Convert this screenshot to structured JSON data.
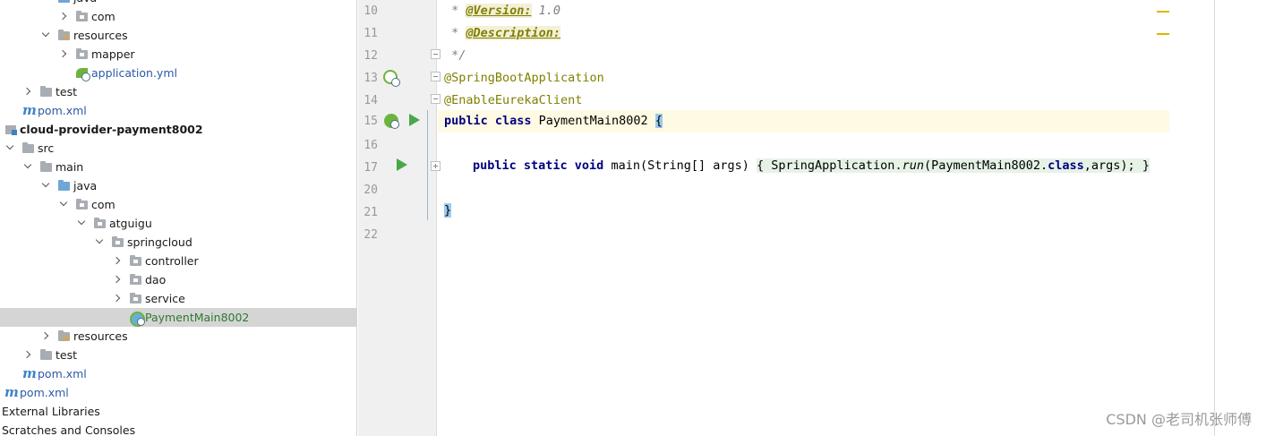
{
  "project_tree": {
    "rows": [
      {
        "label": "java"
      },
      {
        "label": "com"
      },
      {
        "label": "resources"
      },
      {
        "label": "mapper"
      },
      {
        "label": "application.yml"
      },
      {
        "label": "test"
      },
      {
        "label": "pom.xml"
      },
      {
        "label": "cloud-provider-payment8002"
      },
      {
        "label": "src"
      },
      {
        "label": "main"
      },
      {
        "label": "java"
      },
      {
        "label": "com"
      },
      {
        "label": "atguigu"
      },
      {
        "label": "springcloud"
      },
      {
        "label": "controller"
      },
      {
        "label": "dao"
      },
      {
        "label": "service"
      },
      {
        "label": "PaymentMain8002"
      },
      {
        "label": "resources"
      },
      {
        "label": "test"
      },
      {
        "label": "pom.xml"
      },
      {
        "label": "pom.xml"
      },
      {
        "label": "External Libraries"
      },
      {
        "label": "Scratches and Consoles"
      }
    ],
    "icons": {
      "maven": "m",
      "colors": {
        "selected_bg": "#d5d5d5",
        "spring_green": "#6db33f",
        "maven_blue": "#3f84c8"
      }
    }
  },
  "editor": {
    "line_numbers": [
      "10",
      "11",
      "12",
      "13",
      "14",
      "15",
      "16",
      "17",
      "20",
      "21",
      "22"
    ],
    "lines": {
      "l10_prefix": " * ",
      "l10_tag": "@Version:",
      "l10_value": " 1.0",
      "l11_prefix": " * ",
      "l11_tag": "@Description:",
      "l12": " */",
      "l13": "@SpringBootApplication",
      "l14": "@EnableEurekaClient",
      "l15_kw": "public class",
      "l15_name": " PaymentMain8002 ",
      "l15_brace": "{",
      "l17_kw": "public static void",
      "l17_sig": " main(String[] args) ",
      "l17_open": "{",
      "l17_body1": " SpringApplication.",
      "l17_run": "run",
      "l17_body2": "(PaymentMain8002.",
      "l17_class": "class",
      "l17_body3": ",args); ",
      "l17_close": "}",
      "l21": "}"
    },
    "colors": {
      "keyword": "#000080",
      "annotation": "#808000",
      "comment": "#808080",
      "caret_line": "#fffae3"
    }
  },
  "watermark": "CSDN @老司机张师傅"
}
